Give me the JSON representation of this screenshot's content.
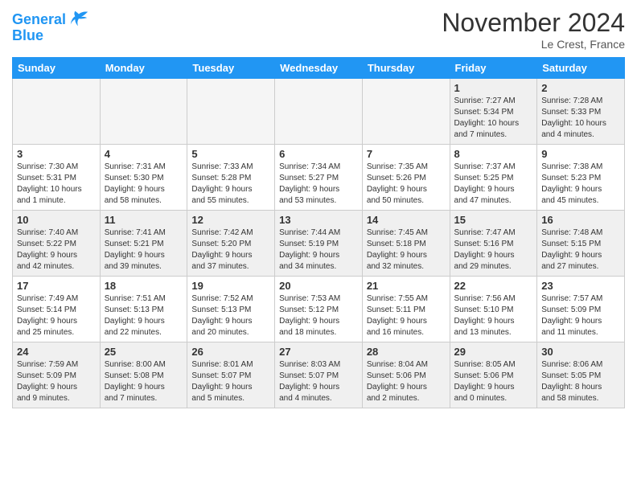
{
  "header": {
    "logo_line1": "General",
    "logo_line2": "Blue",
    "title": "November 2024",
    "location": "Le Crest, France"
  },
  "days_of_week": [
    "Sunday",
    "Monday",
    "Tuesday",
    "Wednesday",
    "Thursday",
    "Friday",
    "Saturday"
  ],
  "weeks": [
    [
      {
        "num": "",
        "info": "",
        "empty": true
      },
      {
        "num": "",
        "info": "",
        "empty": true
      },
      {
        "num": "",
        "info": "",
        "empty": true
      },
      {
        "num": "",
        "info": "",
        "empty": true
      },
      {
        "num": "",
        "info": "",
        "empty": true
      },
      {
        "num": "1",
        "info": "Sunrise: 7:27 AM\nSunset: 5:34 PM\nDaylight: 10 hours\nand 7 minutes."
      },
      {
        "num": "2",
        "info": "Sunrise: 7:28 AM\nSunset: 5:33 PM\nDaylight: 10 hours\nand 4 minutes."
      }
    ],
    [
      {
        "num": "3",
        "info": "Sunrise: 7:30 AM\nSunset: 5:31 PM\nDaylight: 10 hours\nand 1 minute."
      },
      {
        "num": "4",
        "info": "Sunrise: 7:31 AM\nSunset: 5:30 PM\nDaylight: 9 hours\nand 58 minutes."
      },
      {
        "num": "5",
        "info": "Sunrise: 7:33 AM\nSunset: 5:28 PM\nDaylight: 9 hours\nand 55 minutes."
      },
      {
        "num": "6",
        "info": "Sunrise: 7:34 AM\nSunset: 5:27 PM\nDaylight: 9 hours\nand 53 minutes."
      },
      {
        "num": "7",
        "info": "Sunrise: 7:35 AM\nSunset: 5:26 PM\nDaylight: 9 hours\nand 50 minutes."
      },
      {
        "num": "8",
        "info": "Sunrise: 7:37 AM\nSunset: 5:25 PM\nDaylight: 9 hours\nand 47 minutes."
      },
      {
        "num": "9",
        "info": "Sunrise: 7:38 AM\nSunset: 5:23 PM\nDaylight: 9 hours\nand 45 minutes."
      }
    ],
    [
      {
        "num": "10",
        "info": "Sunrise: 7:40 AM\nSunset: 5:22 PM\nDaylight: 9 hours\nand 42 minutes."
      },
      {
        "num": "11",
        "info": "Sunrise: 7:41 AM\nSunset: 5:21 PM\nDaylight: 9 hours\nand 39 minutes."
      },
      {
        "num": "12",
        "info": "Sunrise: 7:42 AM\nSunset: 5:20 PM\nDaylight: 9 hours\nand 37 minutes."
      },
      {
        "num": "13",
        "info": "Sunrise: 7:44 AM\nSunset: 5:19 PM\nDaylight: 9 hours\nand 34 minutes."
      },
      {
        "num": "14",
        "info": "Sunrise: 7:45 AM\nSunset: 5:18 PM\nDaylight: 9 hours\nand 32 minutes."
      },
      {
        "num": "15",
        "info": "Sunrise: 7:47 AM\nSunset: 5:16 PM\nDaylight: 9 hours\nand 29 minutes."
      },
      {
        "num": "16",
        "info": "Sunrise: 7:48 AM\nSunset: 5:15 PM\nDaylight: 9 hours\nand 27 minutes."
      }
    ],
    [
      {
        "num": "17",
        "info": "Sunrise: 7:49 AM\nSunset: 5:14 PM\nDaylight: 9 hours\nand 25 minutes."
      },
      {
        "num": "18",
        "info": "Sunrise: 7:51 AM\nSunset: 5:13 PM\nDaylight: 9 hours\nand 22 minutes."
      },
      {
        "num": "19",
        "info": "Sunrise: 7:52 AM\nSunset: 5:13 PM\nDaylight: 9 hours\nand 20 minutes."
      },
      {
        "num": "20",
        "info": "Sunrise: 7:53 AM\nSunset: 5:12 PM\nDaylight: 9 hours\nand 18 minutes."
      },
      {
        "num": "21",
        "info": "Sunrise: 7:55 AM\nSunset: 5:11 PM\nDaylight: 9 hours\nand 16 minutes."
      },
      {
        "num": "22",
        "info": "Sunrise: 7:56 AM\nSunset: 5:10 PM\nDaylight: 9 hours\nand 13 minutes."
      },
      {
        "num": "23",
        "info": "Sunrise: 7:57 AM\nSunset: 5:09 PM\nDaylight: 9 hours\nand 11 minutes."
      }
    ],
    [
      {
        "num": "24",
        "info": "Sunrise: 7:59 AM\nSunset: 5:09 PM\nDaylight: 9 hours\nand 9 minutes."
      },
      {
        "num": "25",
        "info": "Sunrise: 8:00 AM\nSunset: 5:08 PM\nDaylight: 9 hours\nand 7 minutes."
      },
      {
        "num": "26",
        "info": "Sunrise: 8:01 AM\nSunset: 5:07 PM\nDaylight: 9 hours\nand 5 minutes."
      },
      {
        "num": "27",
        "info": "Sunrise: 8:03 AM\nSunset: 5:07 PM\nDaylight: 9 hours\nand 4 minutes."
      },
      {
        "num": "28",
        "info": "Sunrise: 8:04 AM\nSunset: 5:06 PM\nDaylight: 9 hours\nand 2 minutes."
      },
      {
        "num": "29",
        "info": "Sunrise: 8:05 AM\nSunset: 5:06 PM\nDaylight: 9 hours\nand 0 minutes."
      },
      {
        "num": "30",
        "info": "Sunrise: 8:06 AM\nSunset: 5:05 PM\nDaylight: 8 hours\nand 58 minutes."
      }
    ]
  ]
}
